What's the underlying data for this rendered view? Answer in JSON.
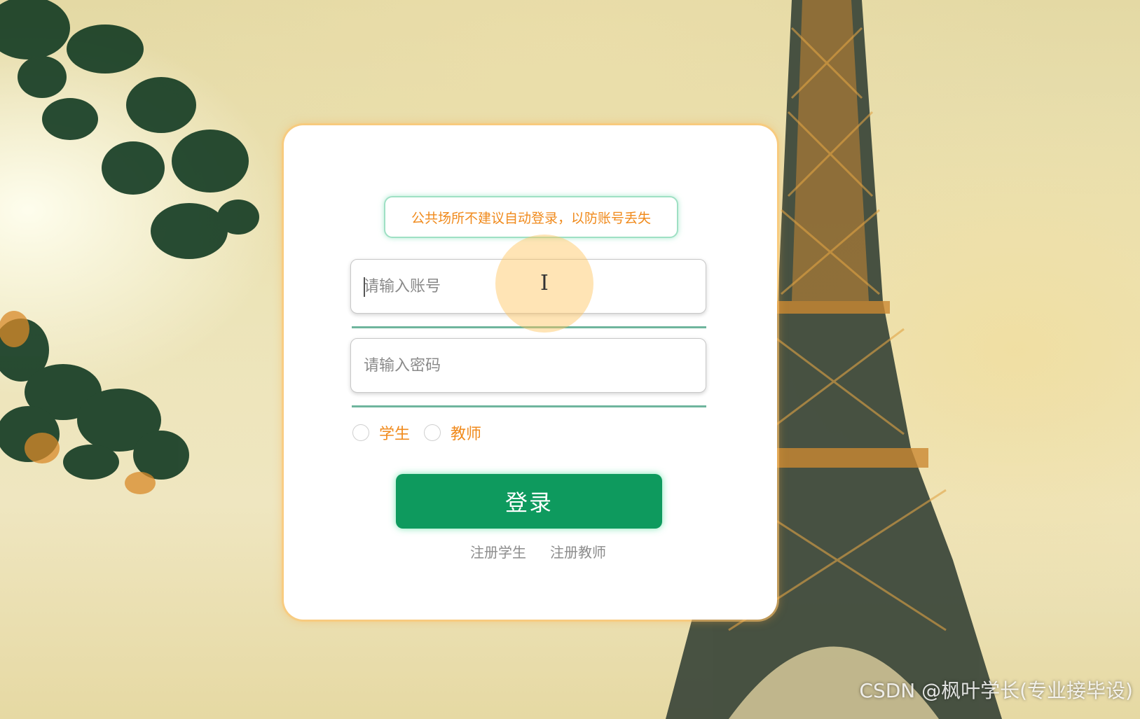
{
  "notice": {
    "text": "公共场所不建议自动登录，以防账号丢失"
  },
  "form": {
    "account_placeholder": "请输入账号",
    "password_placeholder": "请输入密码",
    "roles": [
      {
        "label": "学生",
        "selected": false
      },
      {
        "label": "教师",
        "selected": false
      }
    ],
    "login_label": "登录"
  },
  "links": {
    "register_student": "注册学生",
    "register_teacher": "注册教师"
  },
  "watermark": "CSDN @枫叶学长(专业接毕设)",
  "colors": {
    "notice_text": "#f08a1c",
    "role_label": "#f08a1c",
    "login_button": "#0e9a5e",
    "input_underline": "#6fb59d",
    "card_glow": "#ffaa3c"
  },
  "icons": {
    "cursor": "text-cursor-icon"
  }
}
